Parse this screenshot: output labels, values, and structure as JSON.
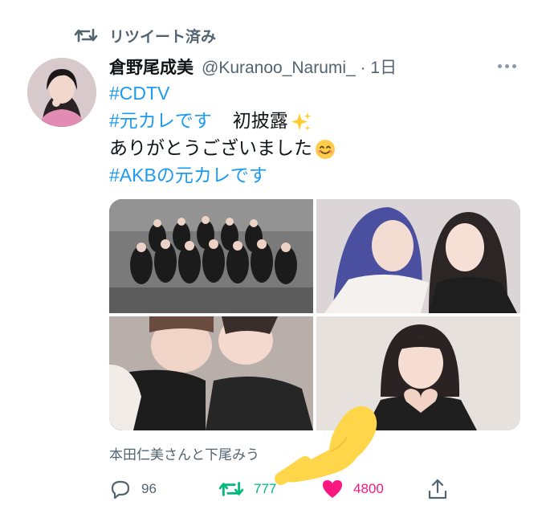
{
  "retweet": {
    "icon": "retweet-icon",
    "label": "リツイート済み"
  },
  "tweet": {
    "author_name": "倉野尾成美",
    "handle_time": "@Kuranoo_Narumi_ · 1日",
    "lines": {
      "hashtag_cdtv": "#CDTV",
      "hashtag_motokare": "#元カレです",
      "debut_text": "初披露",
      "thanks_text": "ありがとうございました",
      "hashtag_akb": "#AKBの元カレです"
    },
    "tagged_text": "本田仁美さんと下尾みう",
    "actions": {
      "replies": "96",
      "retweets": "777",
      "likes": "4800"
    }
  },
  "colors": {
    "link": "#1d9bf0",
    "muted": "#536471",
    "retweet_green": "#00ba7c",
    "like_pink": "#f91880",
    "sticker_yellow": "#ffd54a"
  },
  "icons": {
    "more": "more-dots-icon",
    "reply": "reply-icon",
    "retweet": "retweet-icon",
    "like": "heart-icon",
    "share": "share-icon",
    "sparkles": "sparkles-emoji",
    "smile": "smile-emoji",
    "finger": "pointing-hand-sticker"
  }
}
